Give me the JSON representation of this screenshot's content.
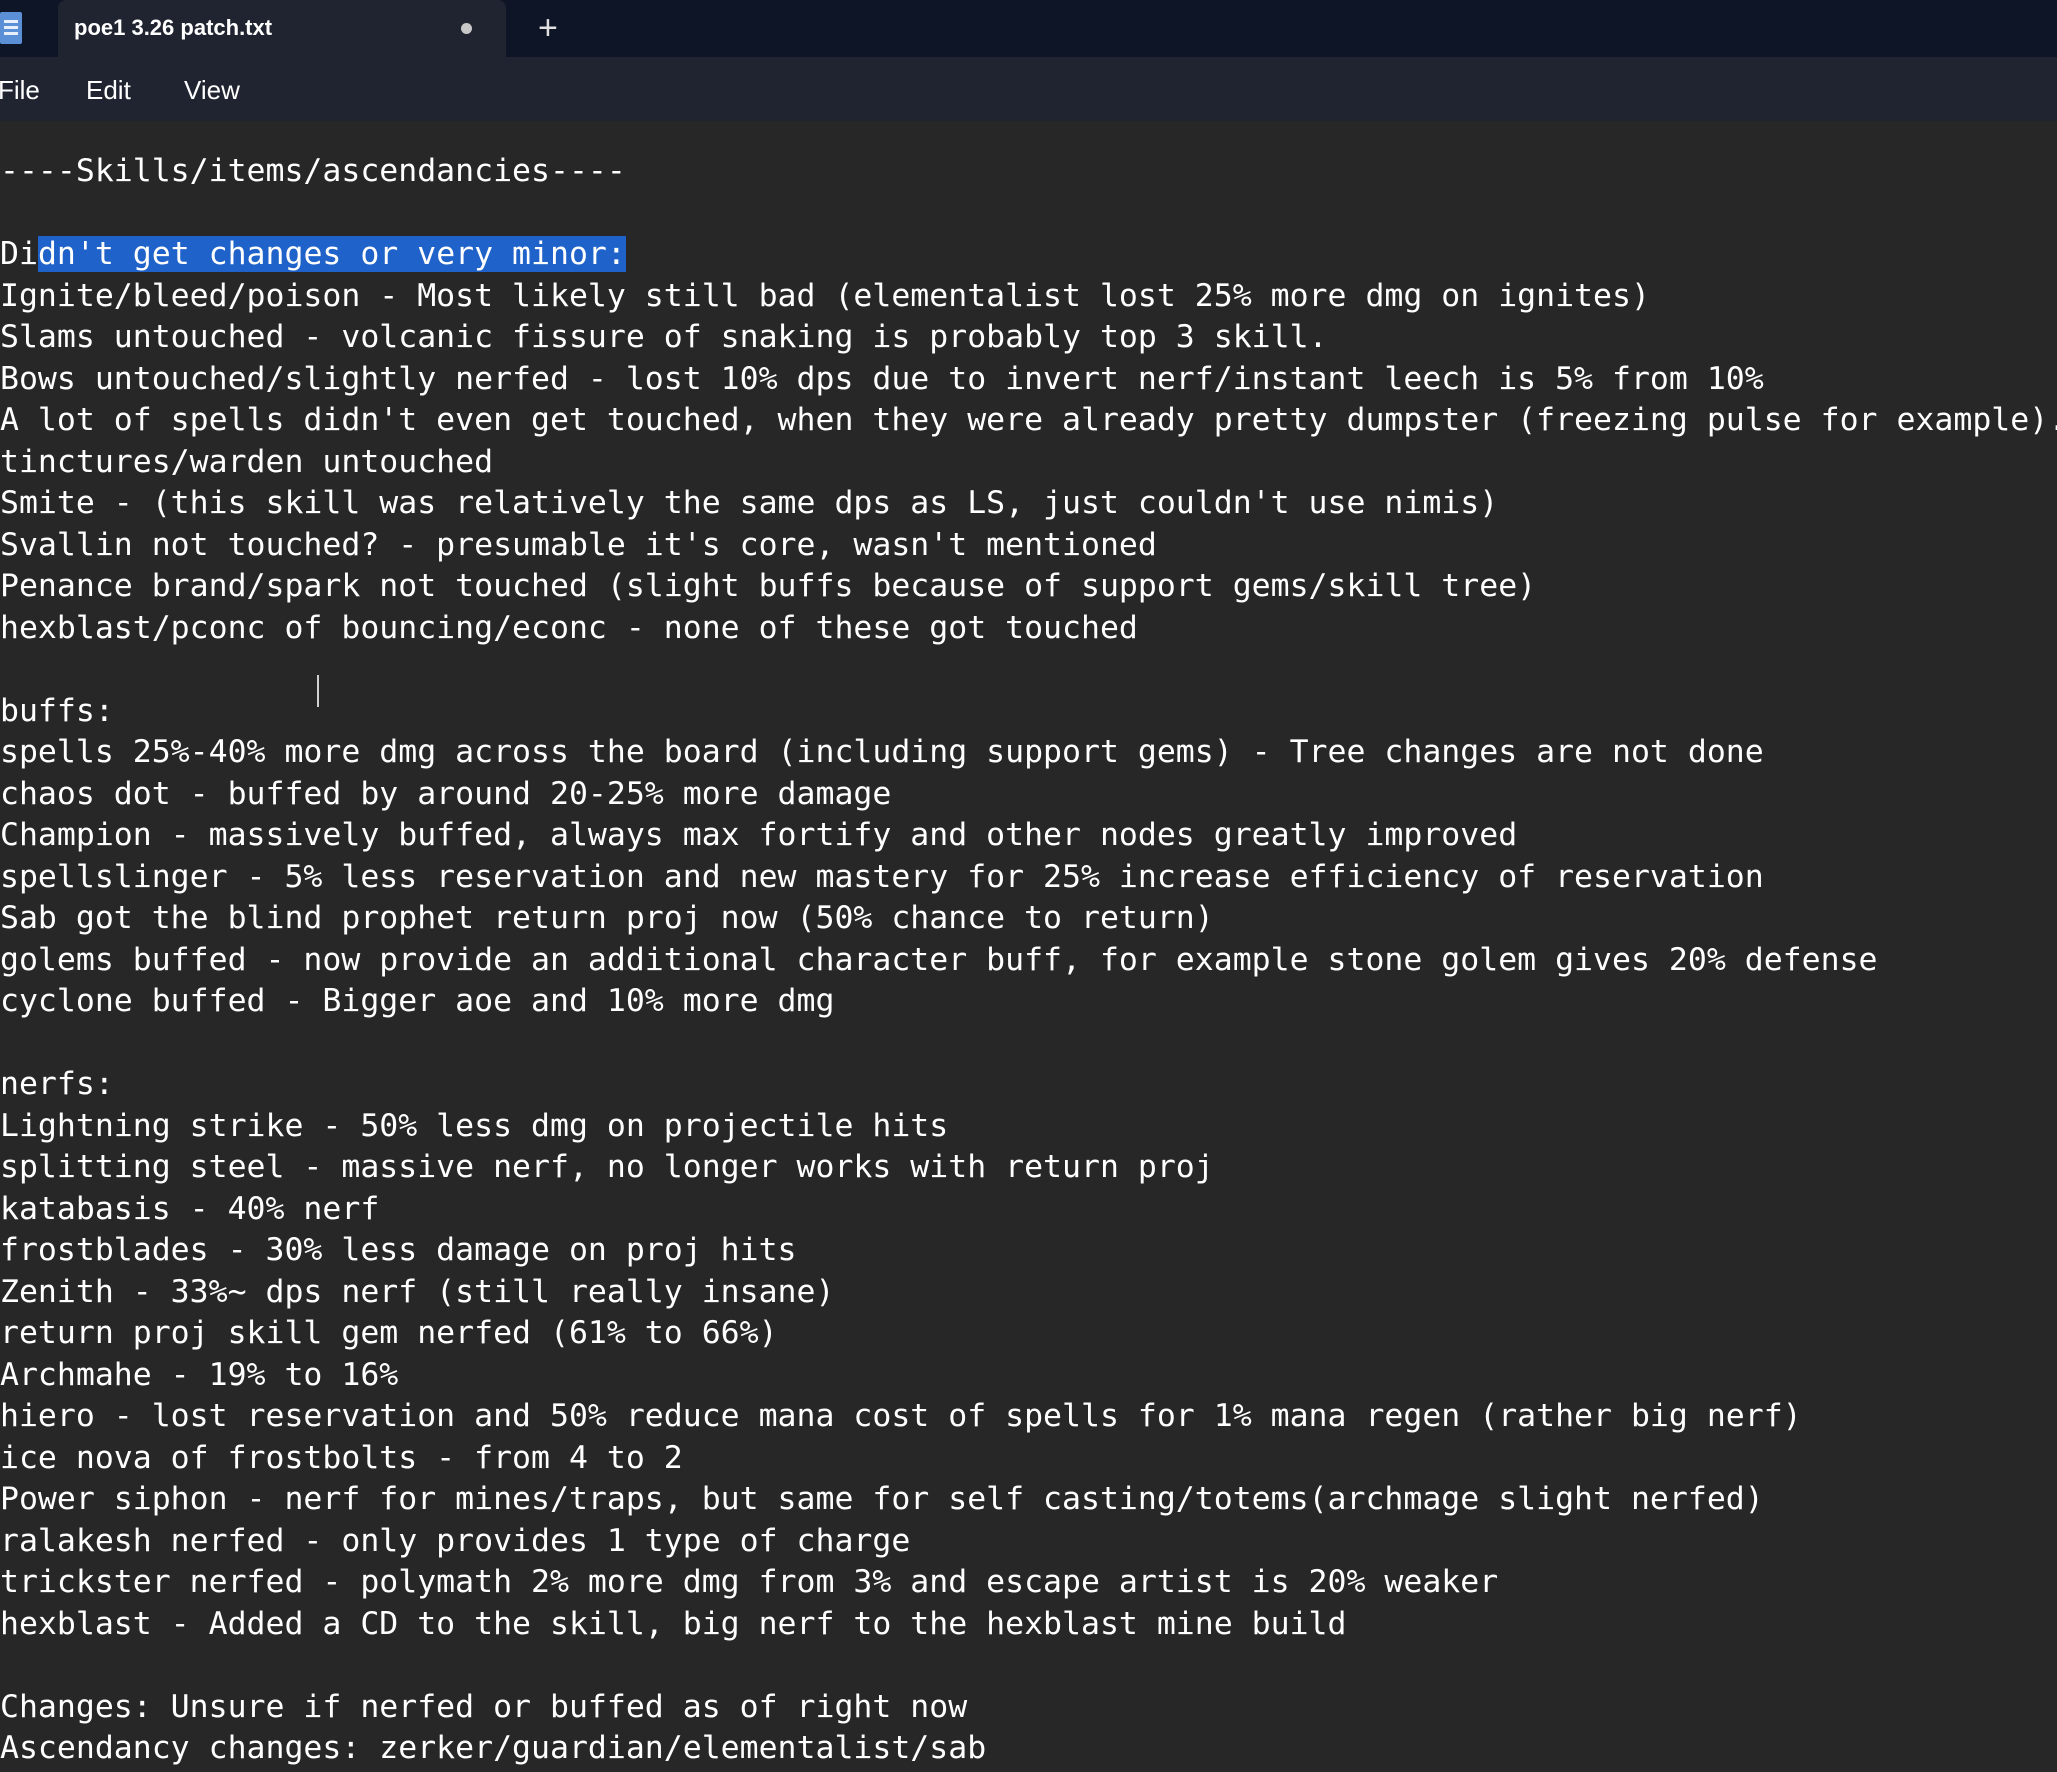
{
  "window": {
    "tab_title": "poe1 3.26 patch.txt",
    "new_tab_label": "+"
  },
  "menu": {
    "file": "File",
    "edit": "Edit",
    "view": "View"
  },
  "editor": {
    "lines": [
      "----Skills/items/ascendancies----",
      "",
      "Didn't get changes or very minor:",
      "Ignite/bleed/poison - Most likely still bad (elementalist lost 25% more dmg on ignites)",
      "Slams untouched - volcanic fissure of snaking is probably top 3 skill.",
      "Bows untouched/slightly nerfed - lost 10% dps due to invert nerf/instant leech is 5% from 10%",
      "A lot of spells didn't even get touched, when they were already pretty dumpster (freezing pulse for example).",
      "tinctures/warden untouched",
      "Smite - (this skill was relatively the same dps as LS, just couldn't use nimis)",
      "Svallin not touched? - presumable it's core, wasn't mentioned",
      "Penance brand/spark not touched (slight buffs because of support gems/skill tree)",
      "hexblast/pconc of bouncing/econc - none of these got touched",
      "",
      "buffs:",
      "spells 25%-40% more dmg across the board (including support gems) - Tree changes are not done",
      "chaos dot - buffed by around 20-25% more damage",
      "Champion - massively buffed, always max fortify and other nodes greatly improved",
      "spellslinger - 5% less reservation and new mastery for 25% increase efficiency of reservation",
      "Sab got the blind prophet return proj now (50% chance to return)",
      "golems buffed - now provide an additional character buff, for example stone golem gives 20% defense",
      "cyclone buffed - Bigger aoe and 10% more dmg",
      "",
      "nerfs:",
      "Lightning strike - 50% less dmg on projectile hits",
      "splitting steel - massive nerf, no longer works with return proj",
      "katabasis - 40% nerf",
      "frostblades - 30% less damage on proj hits",
      "Zenith - 33%~ dps nerf (still really insane)",
      "return proj skill gem nerfed (61% to 66%)",
      "Archmahe - 19% to 16%",
      "hiero - lost reservation and 50% reduce mana cost of spells for 1% mana regen (rather big nerf)",
      "ice nova of frostbolts - from 4 to 2",
      "Power siphon - nerf for mines/traps, but same for self casting/totems(archmage slight nerfed)",
      "ralakesh nerfed - only provides 1 type of charge",
      "trickster nerfed - polymath 2% more dmg from 3% and escape artist is 20% weaker",
      "hexblast - Added a CD to the skill, big nerf to the hexblast mine build",
      "",
      "Changes: Unsure if nerfed or buffed as of right now",
      "Ascendancy changes: zerker/guardian/elementalist/sab"
    ],
    "selection": {
      "line": 2,
      "before": "Di",
      "selected": "dn't get changes or very minor:",
      "after": ""
    }
  }
}
